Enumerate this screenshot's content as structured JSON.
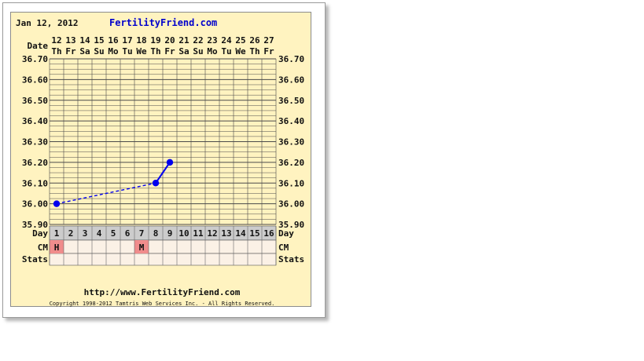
{
  "header": {
    "date": "Jan 12, 2012",
    "brand": "FertilityFriend.com"
  },
  "footer": {
    "url": "http://www.FertilityFriend.com",
    "copyright": "Copyright 1998-2012 Tamtris Web Services Inc. - All Rights Reserved."
  },
  "row_labels": {
    "date": "Date",
    "day": "Day",
    "cm": "CM",
    "stats": "Stats"
  },
  "chart_data": {
    "type": "line",
    "dates": [
      "12",
      "13",
      "14",
      "15",
      "16",
      "17",
      "18",
      "19",
      "20",
      "21",
      "22",
      "23",
      "24",
      "25",
      "26",
      "27"
    ],
    "weekdays": [
      "Th",
      "Fr",
      "Sa",
      "Su",
      "Mo",
      "Tu",
      "We",
      "Th",
      "Fr",
      "Sa",
      "Su",
      "Mo",
      "Tu",
      "We",
      "Th",
      "Fr"
    ],
    "cycle_days": [
      1,
      2,
      3,
      4,
      5,
      6,
      7,
      8,
      9,
      10,
      11,
      12,
      13,
      14,
      15,
      16
    ],
    "y_ticks": [
      "36.70",
      "36.60",
      "36.50",
      "36.40",
      "36.30",
      "36.20",
      "36.10",
      "36.00",
      "35.90"
    ],
    "ylim": [
      35.9,
      36.7
    ],
    "points": [
      {
        "day": 1,
        "temp": 36.0
      },
      {
        "day": 8,
        "temp": 36.1
      },
      {
        "day": 9,
        "temp": 36.2
      }
    ],
    "segments": [
      {
        "from_day": 1,
        "to_day": 8,
        "style": "dashed"
      },
      {
        "from_day": 8,
        "to_day": 9,
        "style": "solid"
      }
    ],
    "cm_markers": [
      {
        "day": 1,
        "label": "H"
      },
      {
        "day": 7,
        "label": "M"
      }
    ],
    "colors": {
      "line": "#0000ee",
      "grid": "#4a4a4a",
      "panel_bg": "#fff3c0",
      "grid_bg": "#fff3c0",
      "day_row_bg": "#cccccc",
      "cm_row_bg": "#fbf1e6",
      "cm_marker_bg": "#f08c8c"
    }
  }
}
